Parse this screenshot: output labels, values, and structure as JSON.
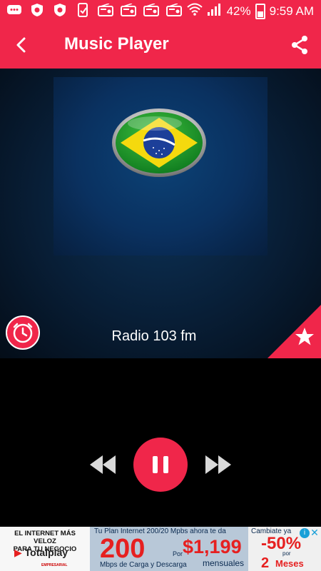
{
  "status_bar": {
    "icons": [
      "chat-icon",
      "shield-icon",
      "shield-icon",
      "phone-icon",
      "radio-icon",
      "radio-icon",
      "radio-icon",
      "radio-icon",
      "wifi-icon",
      "signal-icon"
    ],
    "battery": "42%",
    "time": "9:59 AM"
  },
  "toolbar": {
    "title": "Music Player",
    "back_icon": "chevron-left-icon",
    "share_icon": "share-icon"
  },
  "player": {
    "station_name": "Radio 103 fm",
    "artwork": "brazil-flag-icon",
    "timer_icon": "alarm-clock-icon",
    "favorite_icon": "star-icon"
  },
  "controls": {
    "rewind_icon": "rewind-icon",
    "pause_icon": "pause-icon",
    "forward_icon": "fast-forward-icon"
  },
  "ad": {
    "left_line1": "EL INTERNET MÁS VELOZ",
    "left_line2": "PARA TU NEGOCIO",
    "brand": "Totalplay",
    "brand_sub": "EMPRESARIAL",
    "plan_line": "Tu Plan Internet 200/20 Mpbs ahora te da",
    "speed": "200",
    "por": "Por",
    "price": "$1,199",
    "mbps": "Mbps de Carga y Descarga",
    "mensuales": "mensuales",
    "cambiate": "Cambiate ya",
    "discount": "-50%",
    "por2": "por",
    "months_num": "2",
    "months": "Meses"
  },
  "colors": {
    "accent": "#f0264a",
    "background": "#000000",
    "hero_dark": "#081e36"
  }
}
